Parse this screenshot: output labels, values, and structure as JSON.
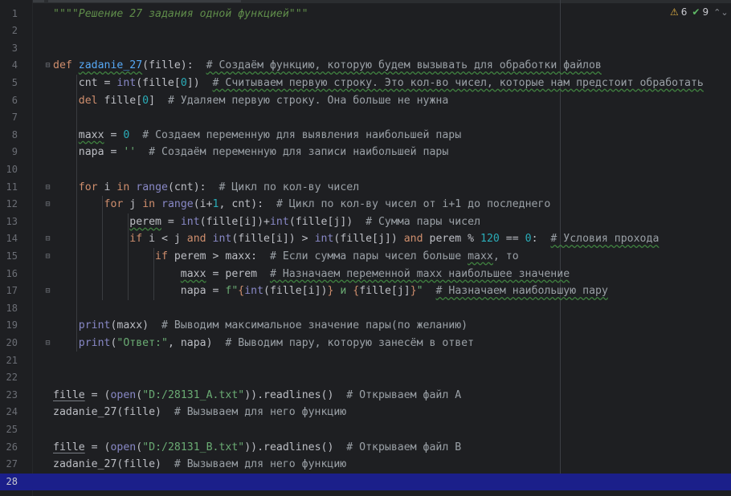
{
  "inspection": {
    "warnings": "6",
    "passed": "9",
    "nav": "⌃⌄"
  },
  "lines": [
    {
      "n": "1",
      "parts": [
        {
          "t": "\"\"\"\"Решение 27 задания одной функцией\"\"\"",
          "c": "doc"
        }
      ]
    },
    {
      "n": "2",
      "parts": []
    },
    {
      "n": "3",
      "parts": []
    },
    {
      "n": "4",
      "parts": [
        {
          "t": "def ",
          "c": "kw"
        },
        {
          "t": "zadanie_27",
          "c": "fn sq"
        },
        {
          "t": "(fille):  ",
          "c": "ident"
        },
        {
          "t": "# Создаём функцию, которую будем вызывать для обработки файлов",
          "c": "cm sq"
        }
      ]
    },
    {
      "n": "5",
      "parts": [
        {
          "t": "    cnt = ",
          "c": "ident"
        },
        {
          "t": "int",
          "c": "bi"
        },
        {
          "t": "(fille[",
          "c": "ident"
        },
        {
          "t": "0",
          "c": "num"
        },
        {
          "t": "])  ",
          "c": "ident"
        },
        {
          "t": "# Считываем первую строку. Это кол-во чисел, которые нам предстоит обработать",
          "c": "cm sq"
        }
      ]
    },
    {
      "n": "6",
      "parts": [
        {
          "t": "    ",
          "c": "ident"
        },
        {
          "t": "del ",
          "c": "kw"
        },
        {
          "t": "fille[",
          "c": "ident"
        },
        {
          "t": "0",
          "c": "num"
        },
        {
          "t": "]  ",
          "c": "ident"
        },
        {
          "t": "# Удаляем первую строку. Она больше не нужна",
          "c": "cm"
        }
      ]
    },
    {
      "n": "7",
      "parts": []
    },
    {
      "n": "8",
      "parts": [
        {
          "t": "    ",
          "c": "ident"
        },
        {
          "t": "maxx",
          "c": "ident sq"
        },
        {
          "t": " = ",
          "c": "ident"
        },
        {
          "t": "0",
          "c": "num"
        },
        {
          "t": "  ",
          "c": "ident"
        },
        {
          "t": "# Создаем переменную для выявления наибольшей пары",
          "c": "cm"
        }
      ]
    },
    {
      "n": "9",
      "parts": [
        {
          "t": "    napa = ",
          "c": "ident"
        },
        {
          "t": "''",
          "c": "str"
        },
        {
          "t": "  ",
          "c": "ident"
        },
        {
          "t": "# Создаём переменную для записи наибольшей пары",
          "c": "cm"
        }
      ]
    },
    {
      "n": "10",
      "parts": []
    },
    {
      "n": "11",
      "parts": [
        {
          "t": "    ",
          "c": "ident"
        },
        {
          "t": "for ",
          "c": "kw"
        },
        {
          "t": "i ",
          "c": "ident"
        },
        {
          "t": "in ",
          "c": "kw"
        },
        {
          "t": "range",
          "c": "bi"
        },
        {
          "t": "(cnt):  ",
          "c": "ident"
        },
        {
          "t": "# Цикл по кол-ву чисел",
          "c": "cm"
        }
      ]
    },
    {
      "n": "12",
      "parts": [
        {
          "t": "        ",
          "c": "ident"
        },
        {
          "t": "for ",
          "c": "kw"
        },
        {
          "t": "j ",
          "c": "ident"
        },
        {
          "t": "in ",
          "c": "kw"
        },
        {
          "t": "range",
          "c": "bi"
        },
        {
          "t": "(i+",
          "c": "ident"
        },
        {
          "t": "1",
          "c": "num"
        },
        {
          "t": ", cnt):  ",
          "c": "ident"
        },
        {
          "t": "# Цикл по кол-ву чисел от i+1 до последнего",
          "c": "cm"
        }
      ]
    },
    {
      "n": "13",
      "parts": [
        {
          "t": "            ",
          "c": "ident"
        },
        {
          "t": "perem",
          "c": "ident sq"
        },
        {
          "t": " = ",
          "c": "ident"
        },
        {
          "t": "int",
          "c": "bi"
        },
        {
          "t": "(fille[i])+",
          "c": "ident"
        },
        {
          "t": "int",
          "c": "bi"
        },
        {
          "t": "(fille[j])  ",
          "c": "ident"
        },
        {
          "t": "# Сумма пары чисел",
          "c": "cm"
        }
      ]
    },
    {
      "n": "14",
      "parts": [
        {
          "t": "            ",
          "c": "ident"
        },
        {
          "t": "if ",
          "c": "kw"
        },
        {
          "t": "i < j ",
          "c": "ident"
        },
        {
          "t": "and ",
          "c": "kw"
        },
        {
          "t": "int",
          "c": "bi"
        },
        {
          "t": "(fille[i]) > ",
          "c": "ident"
        },
        {
          "t": "int",
          "c": "bi"
        },
        {
          "t": "(fille[j]) ",
          "c": "ident"
        },
        {
          "t": "and ",
          "c": "kw"
        },
        {
          "t": "perem % ",
          "c": "ident"
        },
        {
          "t": "120",
          "c": "num"
        },
        {
          "t": " == ",
          "c": "ident"
        },
        {
          "t": "0",
          "c": "num"
        },
        {
          "t": ":  ",
          "c": "ident"
        },
        {
          "t": "# Условия прохода",
          "c": "cm sq"
        }
      ]
    },
    {
      "n": "15",
      "parts": [
        {
          "t": "                ",
          "c": "ident"
        },
        {
          "t": "if ",
          "c": "kw"
        },
        {
          "t": "perem > maxx:  ",
          "c": "ident"
        },
        {
          "t": "# Если сумма пары чисел больше ",
          "c": "cm"
        },
        {
          "t": "maxx",
          "c": "cm sq"
        },
        {
          "t": ", то",
          "c": "cm"
        }
      ]
    },
    {
      "n": "16",
      "parts": [
        {
          "t": "                    ",
          "c": "ident"
        },
        {
          "t": "maxx",
          "c": "ident sq"
        },
        {
          "t": " = perem  ",
          "c": "ident"
        },
        {
          "t": "# Назначаем переменной maxx наибольшее значение",
          "c": "cm sq"
        }
      ]
    },
    {
      "n": "17",
      "parts": [
        {
          "t": "                    napa = ",
          "c": "ident"
        },
        {
          "t": "f\"",
          "c": "str"
        },
        {
          "t": "{",
          "c": "kw"
        },
        {
          "t": "int",
          "c": "bi"
        },
        {
          "t": "(fille[i])",
          "c": "ident"
        },
        {
          "t": "}",
          "c": "kw"
        },
        {
          "t": " и ",
          "c": "str"
        },
        {
          "t": "{",
          "c": "kw"
        },
        {
          "t": "fille[j]",
          "c": "ident"
        },
        {
          "t": "}",
          "c": "kw"
        },
        {
          "t": "\"",
          "c": "str"
        },
        {
          "t": "  ",
          "c": "ident"
        },
        {
          "t": "# Назначаем наибольшую пару",
          "c": "cm sq"
        }
      ]
    },
    {
      "n": "18",
      "parts": []
    },
    {
      "n": "19",
      "parts": [
        {
          "t": "    ",
          "c": "ident"
        },
        {
          "t": "print",
          "c": "bi"
        },
        {
          "t": "(maxx)  ",
          "c": "ident"
        },
        {
          "t": "# Выводим максимальное значение пары(по желанию)",
          "c": "cm"
        }
      ]
    },
    {
      "n": "20",
      "parts": [
        {
          "t": "    ",
          "c": "ident"
        },
        {
          "t": "print",
          "c": "bi"
        },
        {
          "t": "(",
          "c": "ident"
        },
        {
          "t": "\"Ответ:\"",
          "c": "str"
        },
        {
          "t": ", napa)  ",
          "c": "ident"
        },
        {
          "t": "# Выводим пару, которую занесём в ответ",
          "c": "cm"
        }
      ]
    },
    {
      "n": "21",
      "parts": []
    },
    {
      "n": "22",
      "parts": []
    },
    {
      "n": "23",
      "parts": [
        {
          "t": "fille",
          "c": "ident ul"
        },
        {
          "t": " = (",
          "c": "ident"
        },
        {
          "t": "open",
          "c": "bi"
        },
        {
          "t": "(",
          "c": "ident"
        },
        {
          "t": "\"D:/28131_A.txt\"",
          "c": "str"
        },
        {
          "t": ")).readlines()  ",
          "c": "ident"
        },
        {
          "t": "# Открываем файл А",
          "c": "cm"
        }
      ]
    },
    {
      "n": "24",
      "parts": [
        {
          "t": "zadanie_27(fille)  ",
          "c": "ident"
        },
        {
          "t": "# Вызываем для него функцию",
          "c": "cm"
        }
      ]
    },
    {
      "n": "25",
      "parts": []
    },
    {
      "n": "26",
      "parts": [
        {
          "t": "fille",
          "c": "ident ul"
        },
        {
          "t": " = (",
          "c": "ident"
        },
        {
          "t": "open",
          "c": "bi"
        },
        {
          "t": "(",
          "c": "ident"
        },
        {
          "t": "\"D:/28131_B.txt\"",
          "c": "str"
        },
        {
          "t": ")).readlines()  ",
          "c": "ident"
        },
        {
          "t": "# Открываем файл В",
          "c": "cm"
        }
      ]
    },
    {
      "n": "27",
      "parts": [
        {
          "t": "zadanie_27(fille)  ",
          "c": "ident"
        },
        {
          "t": "# Вызываем для него функцию",
          "c": "cm"
        }
      ]
    },
    {
      "n": "28",
      "parts": []
    }
  ],
  "current_line": "28",
  "fold_markers": [
    "4",
    "11",
    "12",
    "14",
    "15",
    "17",
    "20"
  ],
  "colors": {
    "background": "#1e1f22",
    "keyword": "#cf8e6d",
    "function": "#56a8f5",
    "builtin": "#8888c6",
    "number": "#2aacb8",
    "string": "#6aab73",
    "comment": "#9aa0a6",
    "docstring": "#5f8c4a",
    "current_line": "#1b1f8a"
  }
}
